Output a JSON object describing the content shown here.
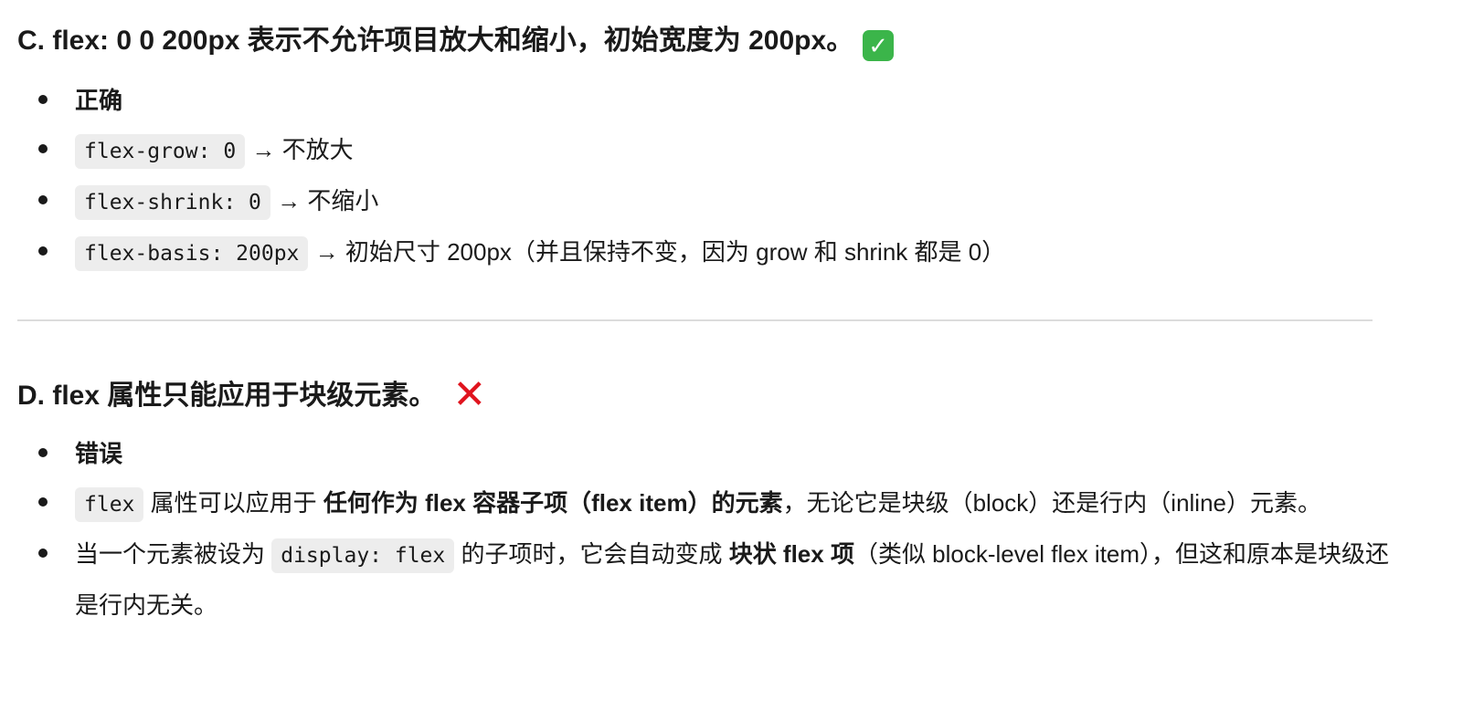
{
  "section_c": {
    "heading": "C. flex: 0 0 200px 表示不允许项目放大和缩小，初始宽度为 200px。",
    "badge_icon": "check-mark-button",
    "badge_color": "#3bb54a",
    "verdict": "正确",
    "items": [
      {
        "code": "flex-grow: 0",
        "text": " → 不放大"
      },
      {
        "code": "flex-shrink: 0",
        "text": " → 不缩小"
      },
      {
        "code": "flex-basis: 200px",
        "text": " → 初始尺寸 200px（并且保持不变，因为 grow 和 shrink 都是 0）"
      }
    ]
  },
  "section_d": {
    "heading": "D. flex 属性只能应用于块级元素。",
    "badge_icon": "cross-mark",
    "badge_color": "#e0141e",
    "verdict": "错误",
    "item1": {
      "code": "flex",
      "text_before": " 属性可以应用于 ",
      "strong": "任何作为 flex 容器子项（flex item）的元素",
      "text_after": "，无论它是块级（block）还是行内（inline）元素。"
    },
    "item2": {
      "text_before": "当一个元素被设为 ",
      "code": "display: flex",
      "text_middle": " 的子项时，它会自动变成 ",
      "strong": "块状 flex 项",
      "text_after": "（类似 block-level flex item），但这和原本是块级还是行内无关。"
    }
  }
}
